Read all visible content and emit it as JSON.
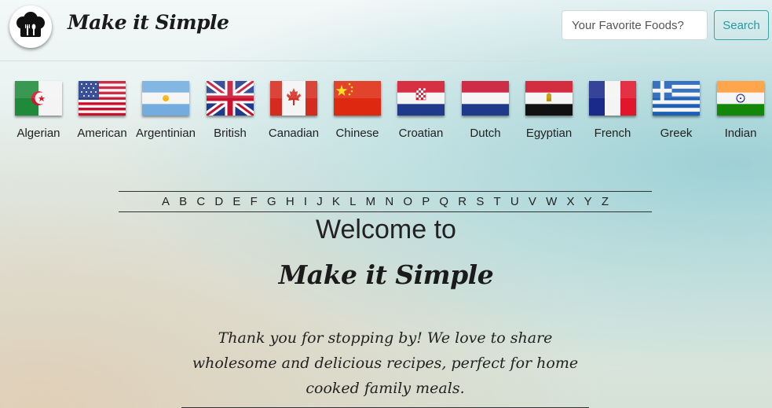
{
  "header": {
    "brand": "Make it Simple",
    "search_placeholder": "Your Favorite Foods?",
    "search_button": "Search"
  },
  "cuisines": [
    {
      "label": "Algerian",
      "icon": "algeria-flag-icon"
    },
    {
      "label": "American",
      "icon": "usa-flag-icon"
    },
    {
      "label": "Argentinian",
      "icon": "argentina-flag-icon"
    },
    {
      "label": "British",
      "icon": "uk-flag-icon"
    },
    {
      "label": "Canadian",
      "icon": "canada-flag-icon"
    },
    {
      "label": "Chinese",
      "icon": "china-flag-icon"
    },
    {
      "label": "Croatian",
      "icon": "croatia-flag-icon"
    },
    {
      "label": "Dutch",
      "icon": "netherlands-flag-icon"
    },
    {
      "label": "Egyptian",
      "icon": "egypt-flag-icon"
    },
    {
      "label": "French",
      "icon": "france-flag-icon"
    },
    {
      "label": "Greek",
      "icon": "greece-flag-icon"
    },
    {
      "label": "Indian",
      "icon": "india-flag-icon"
    }
  ],
  "alphabet": [
    "A",
    "B",
    "C",
    "D",
    "E",
    "F",
    "G",
    "H",
    "I",
    "J",
    "K",
    "L",
    "M",
    "N",
    "O",
    "P",
    "Q",
    "R",
    "S",
    "T",
    "U",
    "V",
    "W",
    "X",
    "Y",
    "Z"
  ],
  "welcome": {
    "line1": "Welcome to",
    "brand": "Make it Simple",
    "intro": "Thank you for stopping by! We love to share wholesome and delicious recipes, perfect for home cooked family meals."
  },
  "colors": {
    "accent": "#2a98a3",
    "text": "#222222"
  }
}
